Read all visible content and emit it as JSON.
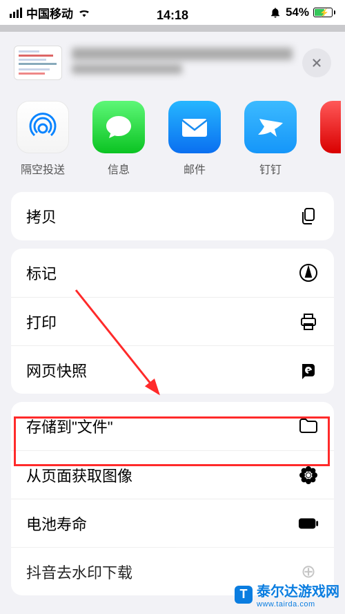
{
  "status": {
    "carrier": "中国移动",
    "time": "14:18",
    "battery_percent": "54%"
  },
  "share_apps": [
    {
      "id": "airdrop",
      "label": "隔空投送"
    },
    {
      "id": "messages",
      "label": "信息"
    },
    {
      "id": "mail",
      "label": "邮件"
    },
    {
      "id": "dingtalk",
      "label": "钉钉"
    }
  ],
  "actions": {
    "copy": "拷贝",
    "markup": "标记",
    "print": "打印",
    "webclip": "网页快照",
    "save_files": "存储到\"文件\"",
    "get_images": "从页面获取图像",
    "battery_life": "电池寿命",
    "douyin": "抖音去水印下载"
  },
  "watermark": {
    "site": "泰尔达游戏网",
    "url": "www.tairda.com"
  }
}
